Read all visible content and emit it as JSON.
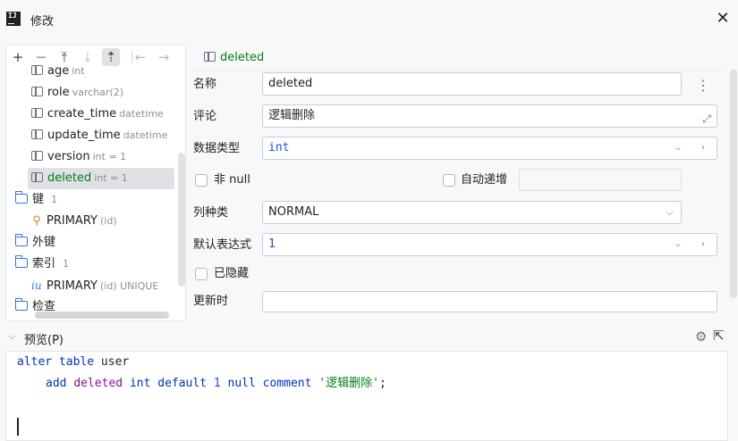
{
  "window": {
    "title": "修改"
  },
  "tree": {
    "toolbar": [
      "+",
      "—",
      "⤒",
      "⤓",
      "⇡",
      "←",
      "→"
    ],
    "columns": [
      {
        "name": "age",
        "type": "int"
      },
      {
        "name": "role",
        "type": "varchar(2)"
      },
      {
        "name": "create_time",
        "type": "datetime"
      },
      {
        "name": "update_time",
        "type": "datetime"
      },
      {
        "name": "version",
        "type": "int = 1"
      },
      {
        "name": "deleted",
        "type": "int = 1"
      }
    ],
    "keys_folder": {
      "label": "键",
      "count": "1"
    },
    "primary_key": {
      "name": "PRIMARY",
      "detail": "(id)"
    },
    "foreign_keys_folder": {
      "label": "外键"
    },
    "indexes_folder": {
      "label": "索引",
      "count": "1"
    },
    "primary_index": {
      "name": "PRIMARY",
      "detail": "(id) UNIQUE"
    },
    "checks_folder": {
      "label": "检查"
    }
  },
  "editor": {
    "header": "deleted",
    "name_label": "名称",
    "name_value": "deleted",
    "comment_label": "评论",
    "comment_value": "逻辑删除",
    "datatype_label": "数据类型",
    "datatype_value": "int",
    "notnull_label": "非 null",
    "autoinc_label": "自动递增",
    "kind_label": "列种类",
    "kind_value": "NORMAL",
    "default_label": "默认表达式",
    "default_value": "1",
    "hidden_label": "已隐藏",
    "onupdate_label": "更新时",
    "onupdate_value": ""
  },
  "preview": {
    "title": "预览(P)",
    "line1_kw": "alter table",
    "line1_id": "user",
    "line2_add": "add",
    "line2_col": "deleted",
    "line2_type": "int",
    "line2_default": "default",
    "line2_num": "1",
    "line2_null": "null",
    "line2_comment": "comment",
    "line2_str": "'逻辑删除'",
    "line2_end": ";"
  }
}
